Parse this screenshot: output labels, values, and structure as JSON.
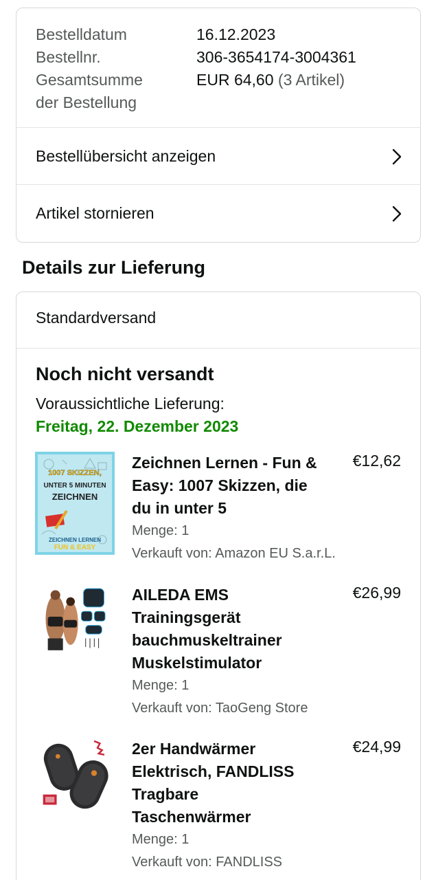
{
  "order": {
    "date_label": "Bestelldatum",
    "date_value": "16.12.2023",
    "number_label": "Bestellnr.",
    "number_value": "306-3654174-3004361",
    "total_label_line1": "Gesamtsumme",
    "total_label_line2": "der Bestellung",
    "total_value": "EUR 64,60",
    "total_items": "(3 Artikel)"
  },
  "links": {
    "overview": "Bestellübersicht anzeigen",
    "cancel": "Artikel stornieren"
  },
  "delivery": {
    "heading": "Details zur Lieferung",
    "method": "Standardversand",
    "status": "Noch nicht versandt",
    "eta_label": "Voraussichtliche Lieferung:",
    "eta_date": "Freitag, 22. Dezember 2023",
    "eta_color": "#108a00"
  },
  "items": [
    {
      "title": "Zeichnen Lernen - Fun & Easy: 1007 Skizzen, die du in unter 5",
      "price": "€12,62",
      "qty": "Menge: 1",
      "seller": "Verkauft von: Amazon EU S.a.r.L.",
      "image_icon": "book-cover-icon",
      "image_text": {
        "l1": "1007 SKIZZEN,",
        "l2": "UNTER 5 MINUTEN",
        "l3": "ZEICHNEN",
        "l4": "ZEICHNEN LERNEN",
        "l5": "FUN & EASY"
      }
    },
    {
      "title": "AILEDA EMS Trainingsgerät bauchmuskeltrainer Muskelstimulator",
      "price": "€26,99",
      "qty": "Menge: 1",
      "seller": "Verkauft von: TaoGeng Store",
      "image_icon": "ems-trainer-icon"
    },
    {
      "title": "2er Handwärmer Elektrisch, FANDLISS Tragbare Taschenwärmer",
      "price": "€24,99",
      "qty": "Menge: 1",
      "seller": "Verkauft von: FANDLISS",
      "image_icon": "hand-warmer-icon"
    }
  ]
}
